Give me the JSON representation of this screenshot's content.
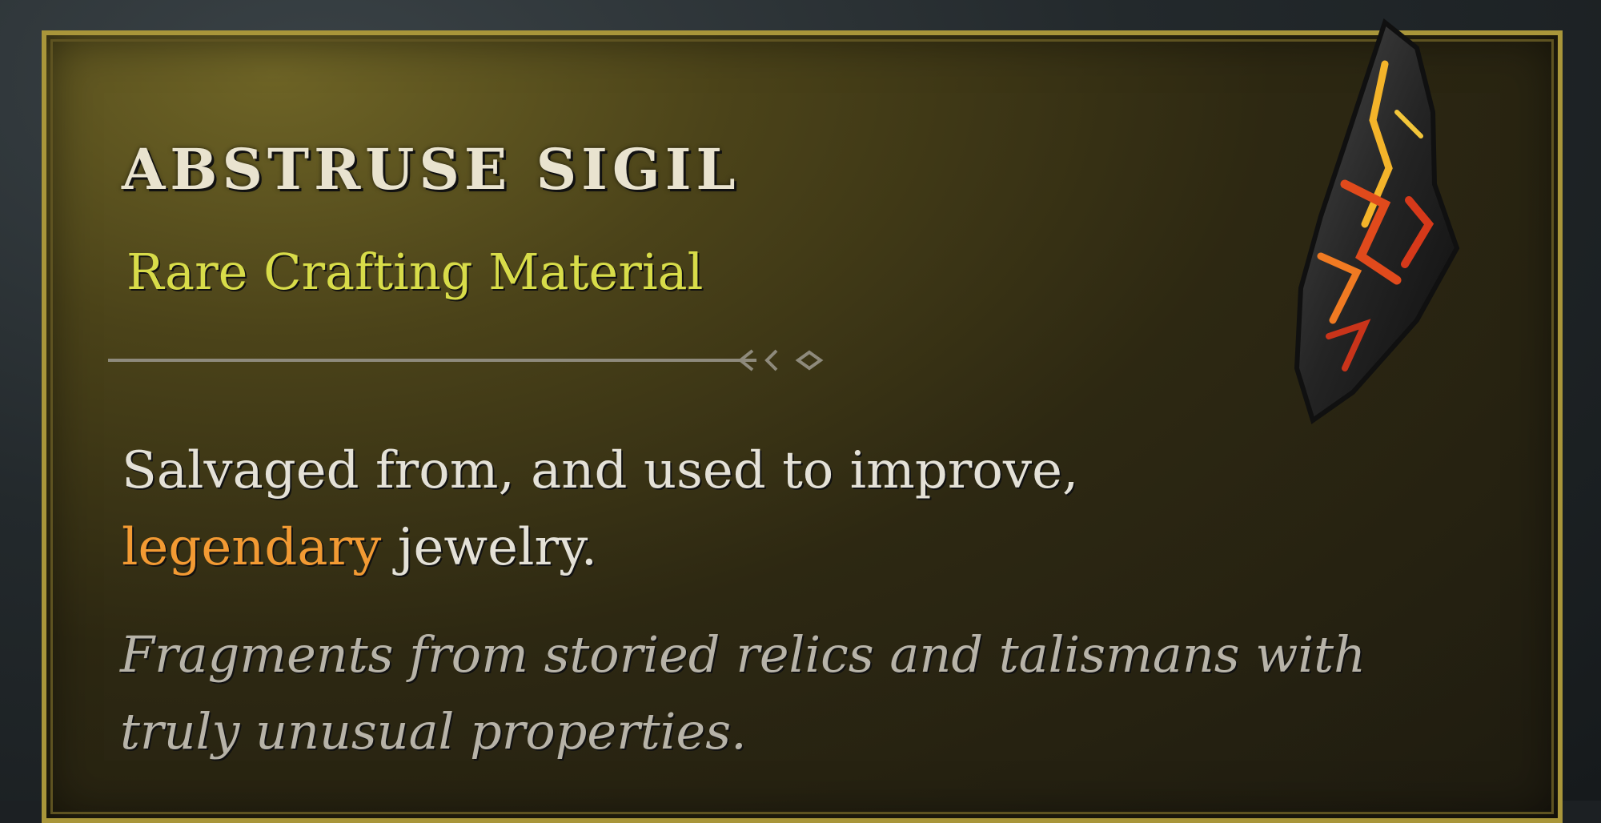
{
  "tooltip": {
    "title": "ABSTRUSE SIGIL",
    "rarity_label": "Rare Crafting Material",
    "description": {
      "part1": "Salvaged from, and used to improve,",
      "highlight": "legendary",
      "part2": " jewelry."
    },
    "flavor_text": "Fragments from storied relics and talismans with truly unusual properties.",
    "icon": "sigil-shard-icon"
  },
  "colors": {
    "title": "#e9e3cf",
    "rarity": "#d8dc49",
    "legendary": "#f29a33",
    "flavor": "#b7b3a8",
    "border": "#a9963a"
  }
}
